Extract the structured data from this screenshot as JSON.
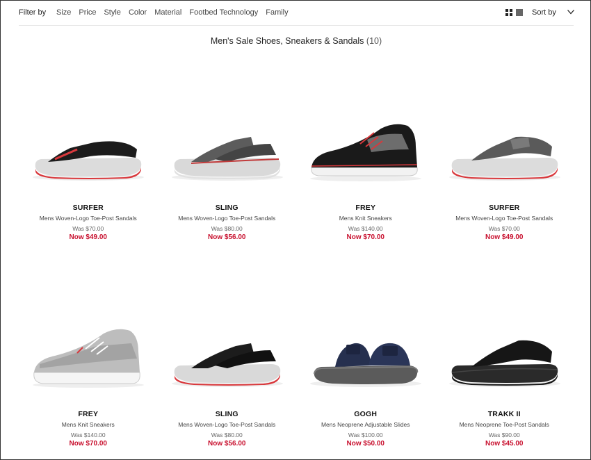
{
  "filterbar": {
    "label": "Filter by",
    "filters": [
      "Size",
      "Price",
      "Style",
      "Color",
      "Material",
      "Footbed Technology",
      "Family"
    ],
    "sort_label": "Sort by"
  },
  "page": {
    "title": "Men's Sale Shoes, Sneakers & Sandals",
    "count": "(10)"
  },
  "products": [
    {
      "name": "SURFER",
      "desc": "Mens Woven-Logo Toe-Post Sandals",
      "was": "Was $70.00",
      "now": "Now $49.00",
      "icon": "black-red-flipflop-icon"
    },
    {
      "name": "SLING",
      "desc": "Mens Woven-Logo Toe-Post Sandals",
      "was": "Was $80.00",
      "now": "Now $56.00",
      "icon": "grey-sling-sandal-icon"
    },
    {
      "name": "FREY",
      "desc": "Mens Knit Sneakers",
      "was": "Was $140.00",
      "now": "Now $70.00",
      "icon": "black-knit-sneaker-icon"
    },
    {
      "name": "SURFER",
      "desc": "Mens Woven-Logo Toe-Post Sandals",
      "was": "Was $70.00",
      "now": "Now $49.00",
      "icon": "grey-flipflop-icon"
    },
    {
      "name": "FREY",
      "desc": "Mens Knit Sneakers",
      "was": "Was $140.00",
      "now": "Now $70.00",
      "icon": "grey-knit-sneaker-icon"
    },
    {
      "name": "SLING",
      "desc": "Mens Woven-Logo Toe-Post Sandals",
      "was": "Was $80.00",
      "now": "Now $56.00",
      "icon": "black-sling-sandal-icon"
    },
    {
      "name": "GOGH",
      "desc": "Mens Neoprene Adjustable Slides",
      "was": "Was $100.00",
      "now": "Now $50.00",
      "icon": "navy-slide-icon"
    },
    {
      "name": "TRAKK II",
      "desc": "Mens Neoprene Toe-Post Sandals",
      "was": "Was $90.00",
      "now": "Now $45.00",
      "icon": "black-flipflop-icon"
    }
  ],
  "colors": {
    "sale_red": "#c8102e",
    "accent_red": "#d9383c"
  }
}
